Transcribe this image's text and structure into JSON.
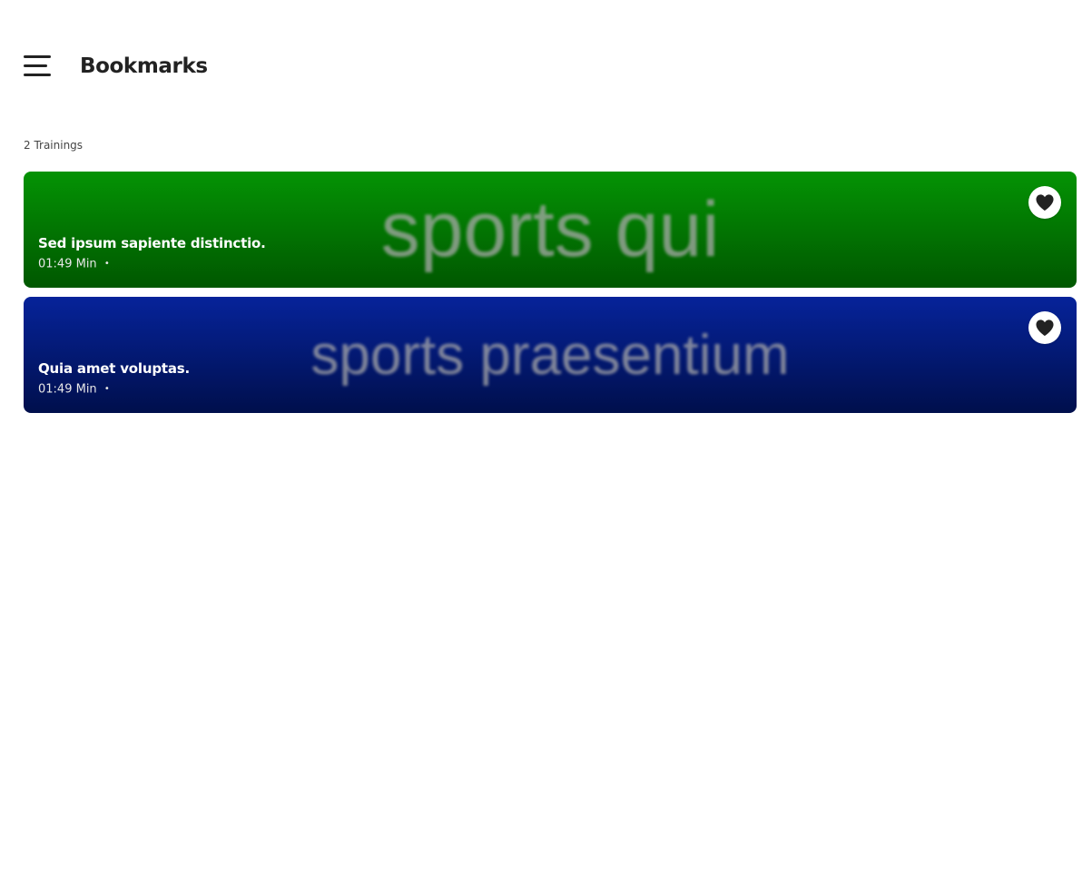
{
  "header": {
    "menu_icon": "hamburger-menu-icon",
    "title": "Bookmarks"
  },
  "list": {
    "count_label": "2 Trainings",
    "items": [
      {
        "title": "Sed ipsum sapiente distinctio.",
        "duration": "01:49 Min",
        "separator": "•",
        "thumbnail_text": "sports qui",
        "gradient_top": "#049304",
        "gradient_bottom": "#005700",
        "bookmarked": true,
        "icon": "heart-icon"
      },
      {
        "title": "Quia amet voluptas.",
        "duration": "01:49 Min",
        "separator": "•",
        "thumbnail_text": "sports praesentium",
        "gradient_top": "#06239a",
        "gradient_bottom": "#000f4c",
        "bookmarked": true,
        "icon": "heart-icon"
      }
    ]
  },
  "colors": {
    "background": "#ffffff",
    "text_primary": "#222222",
    "heart_fill": "#222222"
  }
}
